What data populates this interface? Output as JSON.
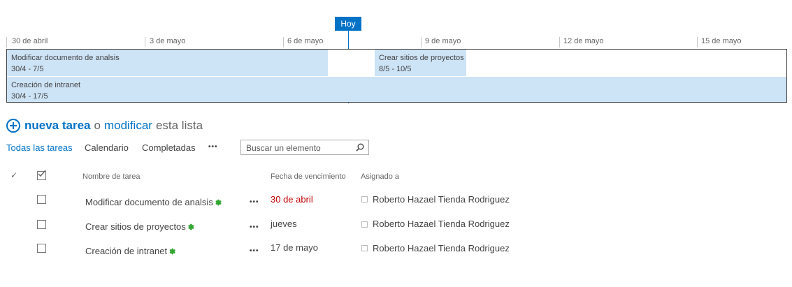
{
  "timeline": {
    "today_label": "Hoy",
    "dates": [
      "30 de abril",
      "3 de mayo",
      "6 de mayo",
      "9 de mayo",
      "12 de mayo",
      "15 de mayo"
    ],
    "bars": [
      {
        "name": "Modificar documento de analsis",
        "range": "30/4 - 7/5"
      },
      {
        "name": "Crear sitios de proyectos",
        "range": "8/5 - 10/5"
      },
      {
        "name": "Creación de intranet",
        "range": "30/4 - 17/5"
      }
    ]
  },
  "new_task": {
    "new_label": "nueva tarea",
    "or_label": "o",
    "edit_label": "modificar",
    "suffix_label": "esta lista"
  },
  "views": {
    "all": "Todas las tareas",
    "calendar": "Calendario",
    "completed": "Completadas",
    "more": "•••"
  },
  "search": {
    "placeholder": "Buscar un elemento"
  },
  "table": {
    "headers": {
      "check_mark": "✓",
      "name": "Nombre de tarea",
      "due": "Fecha de vencimiento",
      "assigned": "Asignado a"
    },
    "rows": [
      {
        "name": "Modificar documento de analsis",
        "due": "30 de abril",
        "assigned": "Roberto Hazael Tienda Rodriguez",
        "overdue": true
      },
      {
        "name": "Crear sitios de proyectos",
        "due": "jueves",
        "assigned": "Roberto Hazael Tienda Rodriguez",
        "overdue": false
      },
      {
        "name": "Creación de intranet",
        "due": "17 de mayo",
        "assigned": "Roberto Hazael Tienda Rodriguez",
        "overdue": false
      }
    ],
    "new_icon": "✽",
    "row_menu": "•••"
  },
  "colors": {
    "accent": "#0072c6",
    "bar_fill": "#cde3f6",
    "overdue": "#bf0000",
    "new_badge": "#33a532"
  }
}
